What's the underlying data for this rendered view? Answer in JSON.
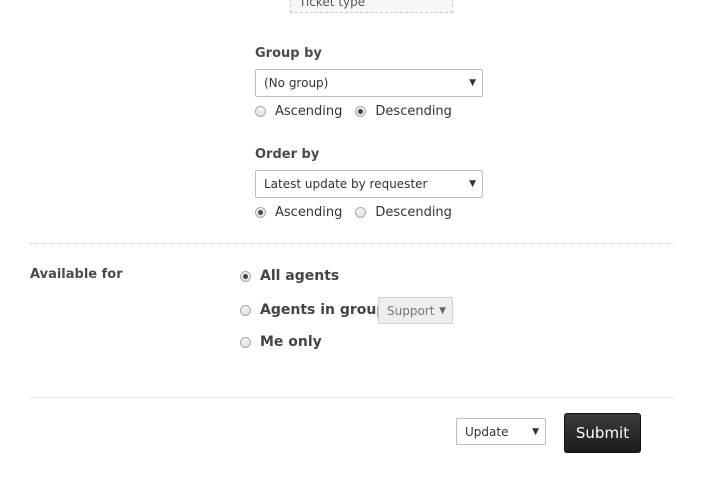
{
  "ticket_chip": {
    "label": "Ticket type"
  },
  "group_by": {
    "label": "Group by",
    "selected": "(No group)",
    "ascending_label": "Ascending",
    "descending_label": "Descending",
    "direction": "descending"
  },
  "order_by": {
    "label": "Order by",
    "selected": "Latest update by requester",
    "ascending_label": "Ascending",
    "descending_label": "Descending",
    "direction": "ascending"
  },
  "available_for": {
    "label": "Available for",
    "options": [
      {
        "label": "All agents",
        "checked": true
      },
      {
        "label": "Agents in group",
        "checked": false
      },
      {
        "label": "Me only",
        "checked": false
      }
    ],
    "group_select": "Support"
  },
  "footer": {
    "action_select": "Update",
    "submit_label": "Submit"
  },
  "icons": {
    "caret": "caret-down-icon"
  }
}
